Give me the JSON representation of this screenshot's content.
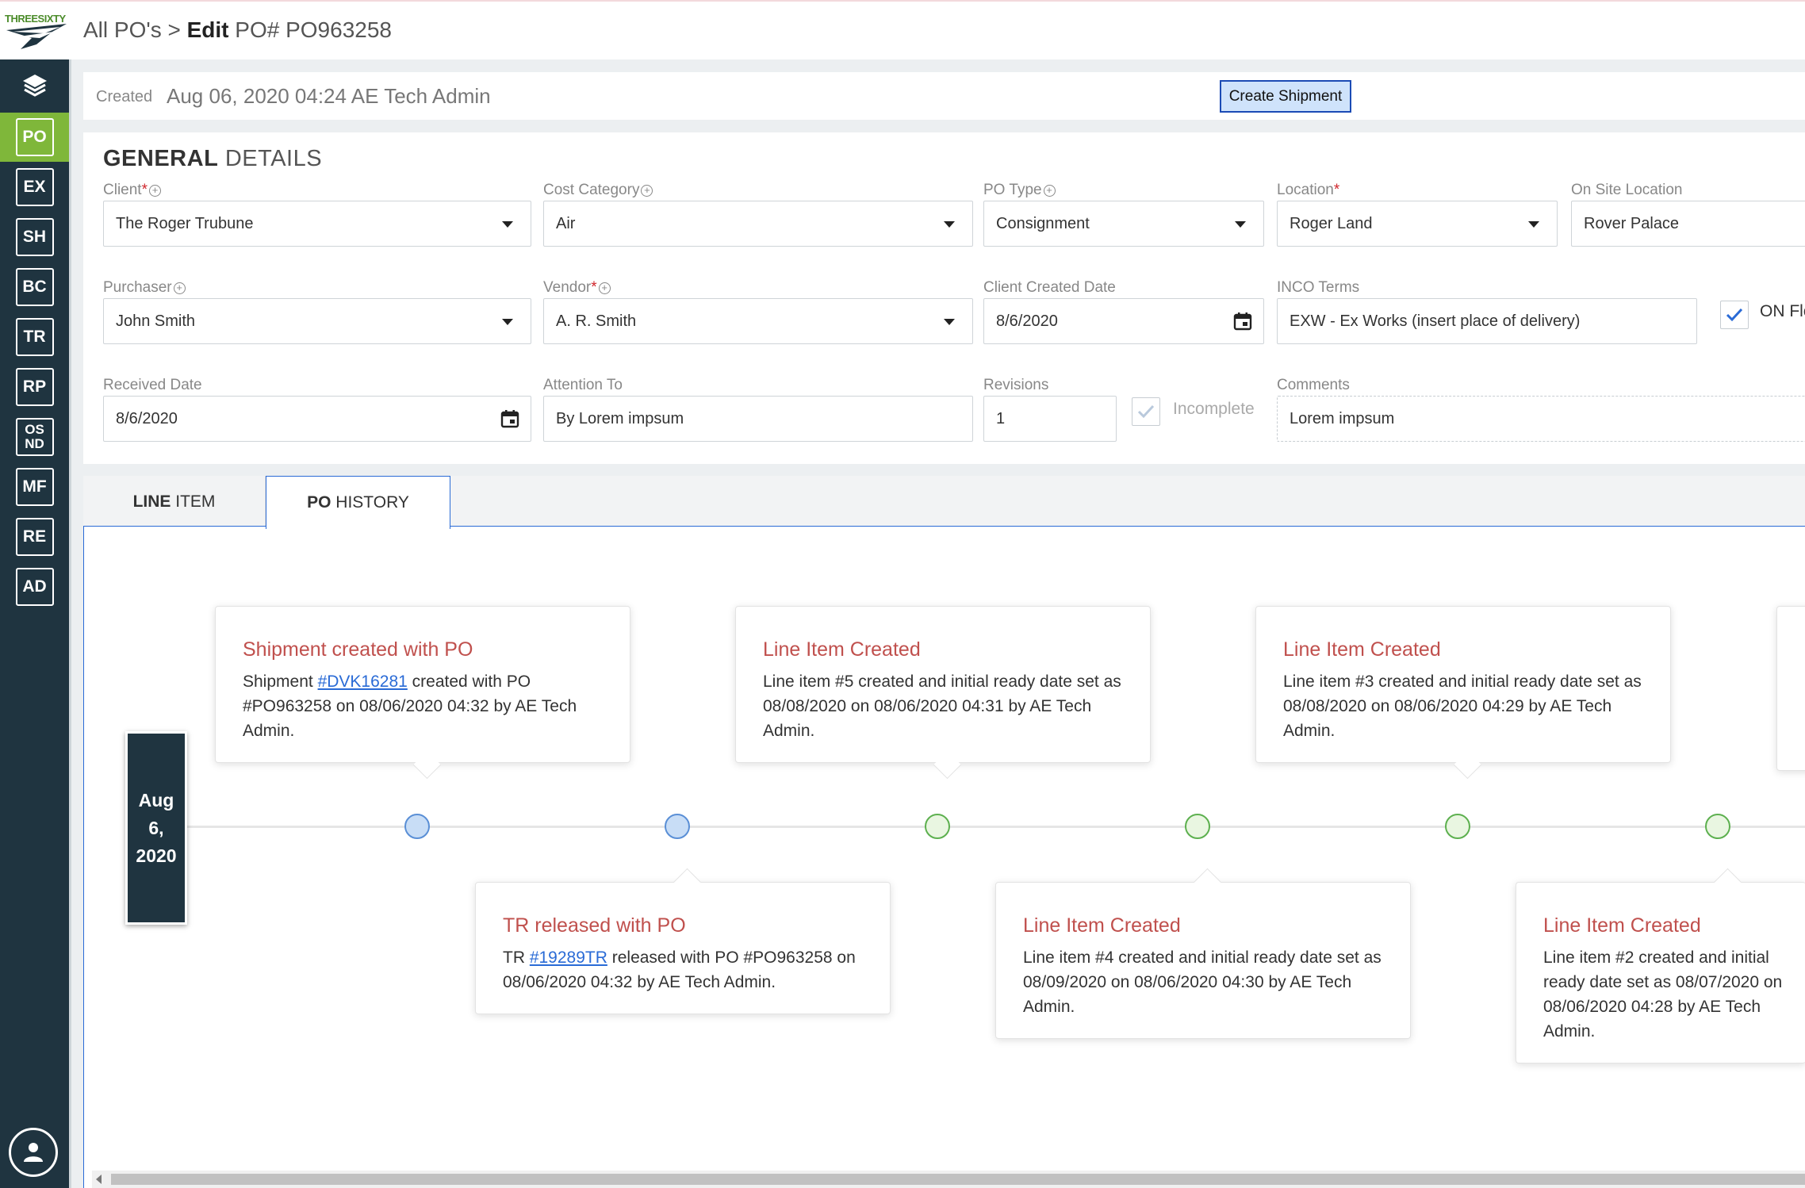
{
  "header": {
    "logo_text": "THREESIXTY",
    "breadcrumb_root": "All PO's >",
    "breadcrumb_edit": "Edit",
    "breadcrumb_po": "PO# PO963258"
  },
  "sidebar": {
    "layers_icon": "layers-icon",
    "items": [
      {
        "label": "PO",
        "active": true
      },
      {
        "label": "EX"
      },
      {
        "label": "SH"
      },
      {
        "label": "BC"
      },
      {
        "label": "TR"
      },
      {
        "label": "RP"
      },
      {
        "label": "OS ND"
      },
      {
        "label": "MF"
      },
      {
        "label": "RE"
      },
      {
        "label": "AD"
      }
    ],
    "user_icon": "user-icon"
  },
  "created": {
    "label": "Created",
    "value": "Aug 06, 2020 04:24 AE Tech Admin",
    "create_shipment_label": "Create Shipment"
  },
  "general_details": {
    "title_bold": "GENERAL",
    "title_rest": "DETAILS",
    "client": {
      "label": "Client",
      "value": "The Roger Trubune"
    },
    "cost_category": {
      "label": "Cost Category",
      "value": "Air"
    },
    "po_type": {
      "label": "PO Type",
      "value": "Consignment"
    },
    "location": {
      "label": "Location",
      "value": "Roger Land"
    },
    "on_site_location": {
      "label": "On Site Location",
      "value": "Rover Palace"
    },
    "purchaser": {
      "label": "Purchaser",
      "value": "John Smith"
    },
    "vendor": {
      "label": "Vendor",
      "value": "A. R. Smith"
    },
    "client_created_date": {
      "label": "Client Created Date",
      "value": "8/6/2020"
    },
    "inco_terms": {
      "label": "INCO Terms",
      "value": "EXW - Ex Works (insert place of delivery)"
    },
    "on_flow_label": "ON Flo",
    "received_date": {
      "label": "Received Date",
      "value": "8/6/2020"
    },
    "attention_to": {
      "label": "Attention To",
      "value": "By Lorem impsum"
    },
    "revisions": {
      "label": "Revisions",
      "value": "1"
    },
    "incomplete_label": "Incomplete",
    "comments": {
      "label": "Comments",
      "value": "Lorem impsum"
    }
  },
  "tabs": {
    "line_item_bold": "LINE",
    "line_item_rest": "ITEM",
    "po_history_bold": "PO",
    "po_history_rest": "HISTORY"
  },
  "history": {
    "date_box": [
      "Aug",
      "6,",
      "2020"
    ],
    "events": [
      {
        "title": "Shipment created with PO",
        "pre": "Shipment ",
        "link": "#DVK16281",
        "post": " created with PO #PO963258 on 08/06/2020 04:32 by AE Tech Admin."
      },
      {
        "title": "TR released with PO",
        "pre": "TR ",
        "link": "#19289TR",
        "post": " released with PO #PO963258 on 08/06/2020 04:32 by AE Tech Admin."
      },
      {
        "title": "Line Item Created",
        "body": "Line item #5 created and initial ready date set as 08/08/2020 on 08/06/2020 04:31 by AE Tech Admin."
      },
      {
        "title": "Line Item Created",
        "body": "Line item #4 created and initial ready date set as 08/09/2020 on 08/06/2020 04:30 by AE Tech Admin."
      },
      {
        "title": "Line Item Created",
        "body": "Line item #3 created and initial ready date set as 08/08/2020 on 08/06/2020 04:29 by AE Tech Admin."
      },
      {
        "title": "Line Item Created",
        "body": "Line item #2 created and initial ready date set as 08/07/2020 on 08/06/2020 04:28 by AE Tech Admin."
      }
    ]
  },
  "colors": {
    "sidebar_bg": "#1f3440",
    "accent_green": "#7fb73a",
    "event_title": "#c0504d",
    "link": "#2a6bd6"
  }
}
